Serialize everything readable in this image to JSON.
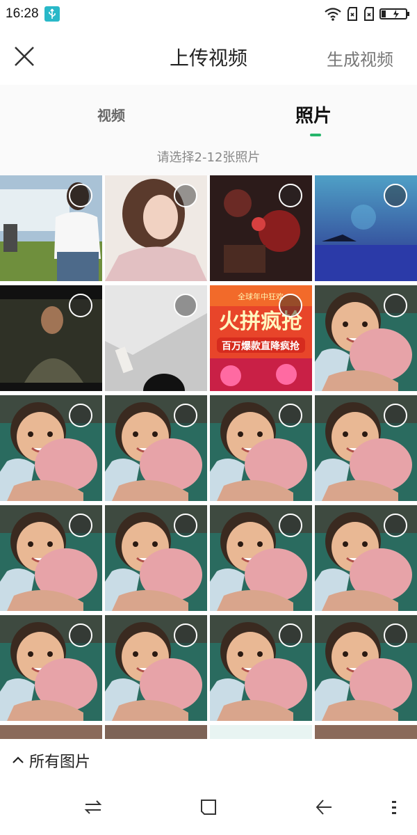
{
  "status": {
    "time": "16:28",
    "usb_icon": "usb-icon",
    "wifi_icon": "wifi-icon",
    "sim1_icon": "no-sim-icon",
    "sim2_icon": "no-sim-icon",
    "battery_icon": "battery-charging-icon"
  },
  "header": {
    "title": "上传视频",
    "generate_label": "生成视频",
    "close_icon": "close-icon"
  },
  "tabs": {
    "video_label": "视频",
    "photo_label": "照片",
    "selected": "照片",
    "hint": "请选择2-12张照片"
  },
  "accent": "#26b56b",
  "photos": [
    {
      "name": "photo-woman-white-shirt",
      "selected": false
    },
    {
      "name": "photo-woman-profile",
      "selected": false
    },
    {
      "name": "photo-red-scene",
      "selected": false
    },
    {
      "name": "photo-blue-night-sky",
      "selected": false
    },
    {
      "name": "photo-man-portrait",
      "selected": false
    },
    {
      "name": "photo-gray-ceiling",
      "selected": false
    },
    {
      "name": "photo-promo-banner",
      "selected": false,
      "text_top": "全球年中狂欢",
      "text_main": "火拼疯抢",
      "text_sub": "百万爆款直降疯抢"
    },
    {
      "name": "photo-baby",
      "selected": false
    },
    {
      "name": "photo-baby",
      "selected": false
    },
    {
      "name": "photo-baby",
      "selected": false
    },
    {
      "name": "photo-baby",
      "selected": false
    },
    {
      "name": "photo-baby",
      "selected": false
    },
    {
      "name": "photo-baby",
      "selected": false
    },
    {
      "name": "photo-baby",
      "selected": false
    },
    {
      "name": "photo-baby",
      "selected": false
    },
    {
      "name": "photo-baby",
      "selected": false
    },
    {
      "name": "photo-baby",
      "selected": false
    },
    {
      "name": "photo-baby",
      "selected": false
    },
    {
      "name": "photo-baby",
      "selected": false
    },
    {
      "name": "photo-baby",
      "selected": false
    }
  ],
  "album": {
    "label": "所有图片",
    "icon": "chevron-up-icon"
  },
  "navbar": {
    "switch_icon": "switch-apps-icon",
    "home_icon": "home-icon",
    "back_icon": "back-icon",
    "menu_icon": "menu-icon"
  }
}
